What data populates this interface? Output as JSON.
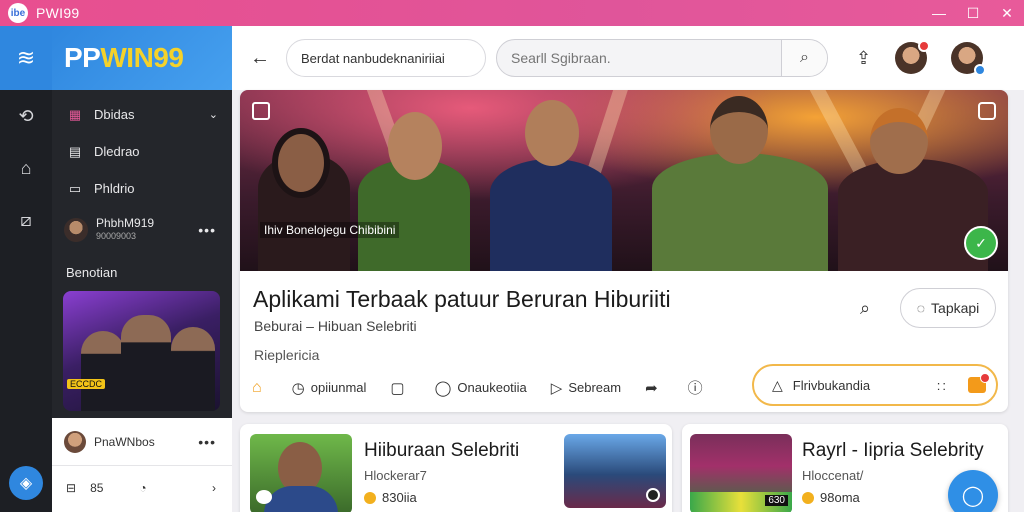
{
  "window": {
    "title": "PWI99",
    "logo_text": "ibe"
  },
  "titlebar_controls": [
    "—",
    "☐",
    "✕"
  ],
  "brand": {
    "part1": "PP",
    "part2": "WIN99"
  },
  "sidebar": {
    "items": [
      {
        "label": "Dbidas",
        "icon": "grid-icon"
      },
      {
        "label": "Dledrao",
        "icon": "clipboard-icon"
      },
      {
        "label": "Phldrio",
        "icon": "document-icon"
      }
    ],
    "user": {
      "name": "PhbhM919",
      "sub": "90009003"
    },
    "section_label": "Benotian",
    "thumb_badge": "ECCDC",
    "row2_label": "PnaWNbos",
    "row3_label": "85"
  },
  "header": {
    "breadcrumb": "Berdat nanbudeknaniriiai",
    "search_placeholder": "Searll Sgibraan."
  },
  "hero": {
    "caption": "Ihiv Bonelojegu Chibibini"
  },
  "main": {
    "title": "Aplikami Terbaak patuur Beruran Hiburiiti",
    "subtitle": "Beburai  –  Hibuan Selebriti",
    "meta": "Rieplericia",
    "tap_button": "Tapkapi",
    "actions": [
      {
        "label": "",
        "icon": "home-icon"
      },
      {
        "label": "opiiunmal",
        "icon": "clock-icon"
      },
      {
        "label": "",
        "icon": "comment-icon"
      },
      {
        "label": "Onaukeotiia",
        "icon": "chat-icon"
      },
      {
        "label": "Sebream",
        "icon": "share-icon"
      },
      {
        "label": "",
        "icon": "forward-icon"
      },
      {
        "label": "",
        "icon": "info-icon"
      }
    ],
    "pill_label": "Flrivbukandia",
    "pill_dots": "::"
  },
  "cards": [
    {
      "title": "Hiiburaan Selebriti",
      "sub": "Hlockerar7",
      "views": "830iia"
    },
    {
      "title": "Rayrl - Iipria Selebrity",
      "sub": "Hloccenat/",
      "views": "98oma",
      "img_badge": "630"
    }
  ],
  "colors": {
    "accent": "#2f87df",
    "titlebar": "#e0559a",
    "brand_yellow": "#f5d22a",
    "pill_border": "#f2b84a",
    "success": "#3cb64a"
  }
}
